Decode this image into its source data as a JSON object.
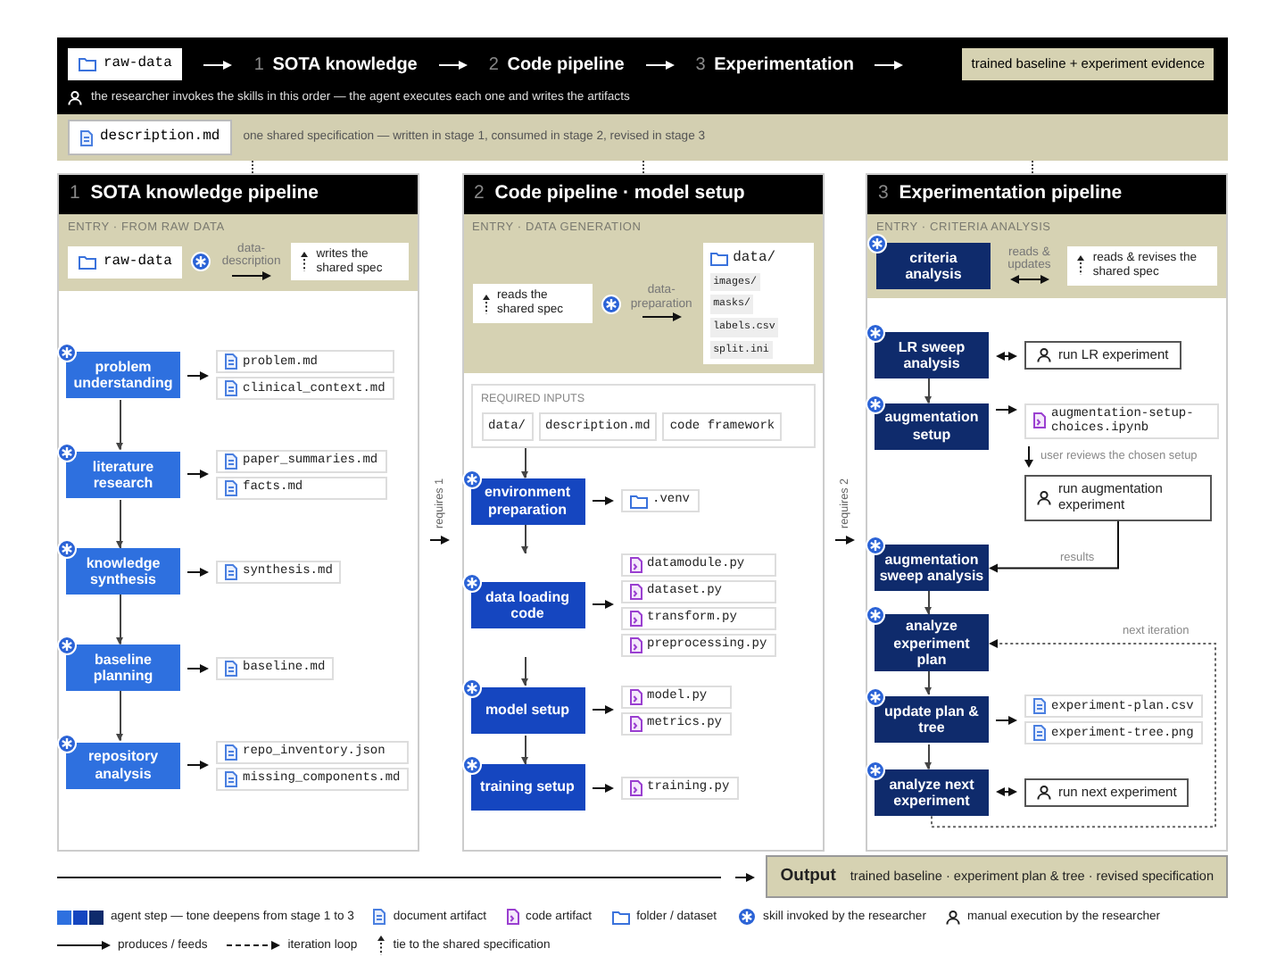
{
  "header": {
    "source": {
      "kind": "folder",
      "name": "raw-data"
    },
    "stages": [
      {
        "number": "1",
        "label": "SOTA knowledge"
      },
      {
        "number": "2",
        "label": "Code pipeline"
      },
      {
        "number": "3",
        "label": "Experimentation"
      }
    ],
    "result": "trained baseline + experiment evidence",
    "note": "the researcher invokes the skills in this order — the agent executes each one and writes the artifacts"
  },
  "spec": {
    "file": "description.md",
    "note": "one shared specification — written in stage 1, consumed in stage 2, revised in stage 3"
  },
  "pipelines": [
    {
      "number": "1",
      "title": "SOTA knowledge pipeline",
      "color": "#2e70df",
      "entry": {
        "label": "ENTRY · FROM RAW DATA",
        "items": [
          {
            "kind": "folder",
            "name": "raw-data"
          },
          {
            "kind": "skill"
          },
          {
            "kind": "link",
            "label": "data-description",
            "two_way": false
          },
          {
            "kind": "tie",
            "text": "writes the shared spec"
          }
        ]
      },
      "steps": [
        {
          "label": "problem understanding",
          "from_above": false,
          "two_way": false,
          "outputs": [
            {
              "kind": "doc",
              "name": "problem.md"
            },
            {
              "kind": "doc",
              "name": "clinical_context.md"
            }
          ]
        },
        {
          "label": "literature research",
          "from_above": true,
          "two_way": false,
          "outputs": [
            {
              "kind": "doc",
              "name": "paper_summaries.md"
            },
            {
              "kind": "doc",
              "name": "facts.md"
            }
          ]
        },
        {
          "label": "knowledge synthesis",
          "from_above": true,
          "two_way": false,
          "outputs": [
            {
              "kind": "doc",
              "name": "synthesis.md"
            }
          ]
        },
        {
          "label": "baseline planning",
          "from_above": true,
          "two_way": false,
          "outputs": [
            {
              "kind": "doc",
              "name": "baseline.md"
            }
          ]
        },
        {
          "label": "repository analysis",
          "from_above": true,
          "two_way": false,
          "outputs": [
            {
              "kind": "doc",
              "name": "repo_inventory.json"
            },
            {
              "kind": "doc",
              "name": "missing_components.md"
            }
          ]
        }
      ],
      "requires": "requires 1"
    },
    {
      "number": "2",
      "title": "Code pipeline · model setup",
      "color": "#1546c0",
      "entry": {
        "label": "ENTRY · DATA GENERATION",
        "items": [
          {
            "kind": "tie",
            "text": "reads the shared spec"
          },
          {
            "kind": "skill"
          },
          {
            "kind": "link",
            "label": "data-preparation",
            "two_way": false
          },
          {
            "kind": "folder_card",
            "name": "data/",
            "contents": [
              "images/",
              "masks/",
              "labels.csv",
              "split.ini"
            ]
          }
        ]
      },
      "inputs": {
        "label": "REQUIRED INPUTS",
        "items": [
          "data/",
          "description.md",
          "code framework"
        ]
      },
      "steps": [
        {
          "label": "environment preparation",
          "from_above": true,
          "two_way": false,
          "outputs": [
            {
              "kind": "folder",
              "name": ".venv"
            }
          ]
        },
        {
          "label": "data loading code",
          "from_above": true,
          "two_way": false,
          "outputs": [
            {
              "kind": "code",
              "name": "datamodule.py"
            },
            {
              "kind": "code",
              "name": "dataset.py"
            },
            {
              "kind": "code",
              "name": "transform.py"
            },
            {
              "kind": "code",
              "name": "preprocessing.py"
            }
          ]
        },
        {
          "label": "model setup",
          "from_above": true,
          "two_way": false,
          "outputs": [
            {
              "kind": "code",
              "name": "model.py"
            },
            {
              "kind": "code",
              "name": "metrics.py"
            }
          ]
        },
        {
          "label": "training setup",
          "from_above": true,
          "two_way": false,
          "outputs": [
            {
              "kind": "code",
              "name": "training.py"
            }
          ]
        }
      ],
      "requires": "requires 2"
    },
    {
      "number": "3",
      "title": "Experimentation pipeline",
      "color": "#0f2b6c",
      "entry": {
        "label": "ENTRY · CRITERIA ANALYSIS",
        "items": [
          {
            "kind": "step",
            "label": "criteria analysis"
          },
          {
            "kind": "link",
            "label": "reads & updates",
            "two_way": true
          },
          {
            "kind": "tie",
            "text": "reads & revises the shared spec"
          }
        ]
      },
      "steps": [
        {
          "label": "LR sweep analysis",
          "from_above": false,
          "two_way": true,
          "outputs": [
            {
              "kind": "manual",
              "name": "run LR experiment"
            }
          ]
        },
        {
          "label": "augmentation setup",
          "from_above": true,
          "two_way": false,
          "outputs": [
            {
              "kind": "code",
              "name": "augmentation-setup-choices.ipynb"
            }
          ],
          "review": "user reviews the chosen setup",
          "then": {
            "kind": "manual",
            "name": "run augmentation experiment"
          }
        },
        {
          "label": "augmentation sweep analysis",
          "from_above": false,
          "feedback": "results"
        },
        {
          "label": "analyze experiment plan",
          "from_above": true,
          "loop_in": "next iteration"
        },
        {
          "label": "update plan & tree",
          "from_above": true,
          "two_way": false,
          "outputs": [
            {
              "kind": "doc",
              "name": "experiment-plan.csv"
            },
            {
              "kind": "doc",
              "name": "experiment-tree.png"
            }
          ]
        },
        {
          "label": "analyze next experiment",
          "from_above": true,
          "two_way": true,
          "loop_out": true,
          "outputs": [
            {
              "kind": "manual",
              "name": "run next experiment"
            }
          ]
        }
      ]
    }
  ],
  "output": {
    "label": "Output",
    "text": "trained baseline · experiment plan & tree · revised specification"
  },
  "legend": [
    [
      {
        "kind": "swatches",
        "text": "agent step — tone deepens from stage 1 to 3"
      },
      {
        "kind": "doc",
        "text": "document artifact"
      },
      {
        "kind": "code",
        "text": "code artifact"
      },
      {
        "kind": "folder",
        "text": "folder / dataset"
      },
      {
        "kind": "skill",
        "text": "skill invoked by the researcher"
      },
      {
        "kind": "manual",
        "text": "manual execution by the researcher"
      }
    ],
    [
      {
        "kind": "arrow",
        "text": "produces / feeds"
      },
      {
        "kind": "loop",
        "text": "iteration loop"
      },
      {
        "kind": "tie",
        "text": "tie to the shared specification"
      }
    ]
  ]
}
